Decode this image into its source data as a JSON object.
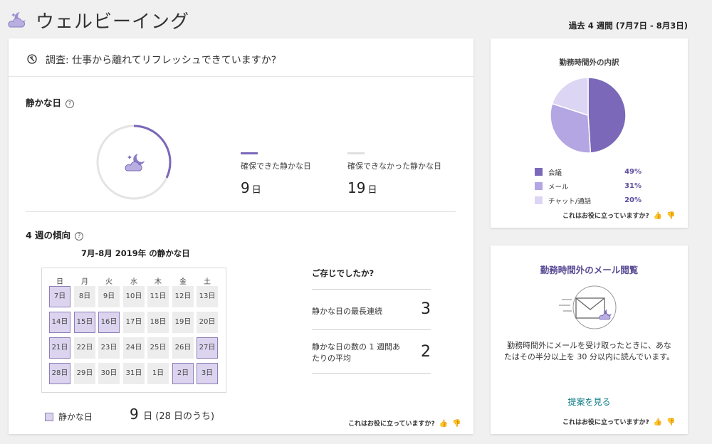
{
  "header": {
    "title": "ウェルビーイング",
    "period": "過去 4 週間 (7月7日 - 8月3日)"
  },
  "survey": {
    "text": "調査: 仕事から離れてリフレッシュできていますか?"
  },
  "quiet_days": {
    "title": "静かな日",
    "help": "?",
    "achieved_label": "確保できた静かな日",
    "achieved_value": "9",
    "missed_label": "確保できなかった静かな日",
    "missed_value": "19",
    "unit": "日",
    "achieved_fraction": 0.32,
    "accent_color": "#7b68b8",
    "missed_color": "#e0e0e0"
  },
  "trend": {
    "title": "4 週の傾向",
    "help": "?",
    "calendar_title": "7月-8月 2019年 の静かな日",
    "weekdays": [
      "日",
      "月",
      "火",
      "水",
      "木",
      "金",
      "土"
    ],
    "weeks": [
      [
        {
          "d": "7日",
          "q": true
        },
        {
          "d": "8日",
          "q": false
        },
        {
          "d": "9日",
          "q": false
        },
        {
          "d": "10日",
          "q": false
        },
        {
          "d": "11日",
          "q": false
        },
        {
          "d": "12日",
          "q": false
        },
        {
          "d": "13日",
          "q": false
        }
      ],
      [
        {
          "d": "14日",
          "q": true
        },
        {
          "d": "15日",
          "q": true
        },
        {
          "d": "16日",
          "q": true
        },
        {
          "d": "17日",
          "q": false
        },
        {
          "d": "18日",
          "q": false
        },
        {
          "d": "19日",
          "q": false
        },
        {
          "d": "20日",
          "q": false
        }
      ],
      [
        {
          "d": "21日",
          "q": true
        },
        {
          "d": "22日",
          "q": false
        },
        {
          "d": "23日",
          "q": false
        },
        {
          "d": "24日",
          "q": false
        },
        {
          "d": "25日",
          "q": false
        },
        {
          "d": "26日",
          "q": false
        },
        {
          "d": "27日",
          "q": true
        }
      ],
      [
        {
          "d": "28日",
          "q": true
        },
        {
          "d": "29日",
          "q": false
        },
        {
          "d": "30日",
          "q": false
        },
        {
          "d": "31日",
          "q": false
        },
        {
          "d": "1日",
          "q": false
        },
        {
          "d": "2日",
          "q": true
        },
        {
          "d": "3日",
          "q": true
        }
      ]
    ],
    "key_label": "静かな日",
    "total_value": "9",
    "total_unit": "日",
    "total_sub": " (28 日のうち)"
  },
  "did_you_know": {
    "title": "ご存じでしたか?",
    "fact1_label": "静かな日の最長連続",
    "fact1_value": "3",
    "fact2_label": "静かな日の数の 1 週間あたりの平均",
    "fact2_value": "2"
  },
  "feedback": {
    "text": "これはお役に立っていますか?",
    "up": "👍",
    "down": "👎"
  },
  "breakdown": {
    "title": "勤務時間外の内訳",
    "items": [
      {
        "label": "会議",
        "pct": "49%",
        "value": 49,
        "color": "#7b68b8"
      },
      {
        "label": "メール",
        "pct": "31%",
        "value": 31,
        "color": "#b3a6e3"
      },
      {
        "label": "チャット/通話",
        "pct": "20%",
        "value": 20,
        "color": "#dcd5f3"
      }
    ]
  },
  "mail": {
    "title": "勤務時間外のメール閲覧",
    "text": "勤務時間外にメールを受け取ったときに、あなたはその半分以上を 30 分以内に読んでいます。",
    "link": "提案を見る"
  }
}
